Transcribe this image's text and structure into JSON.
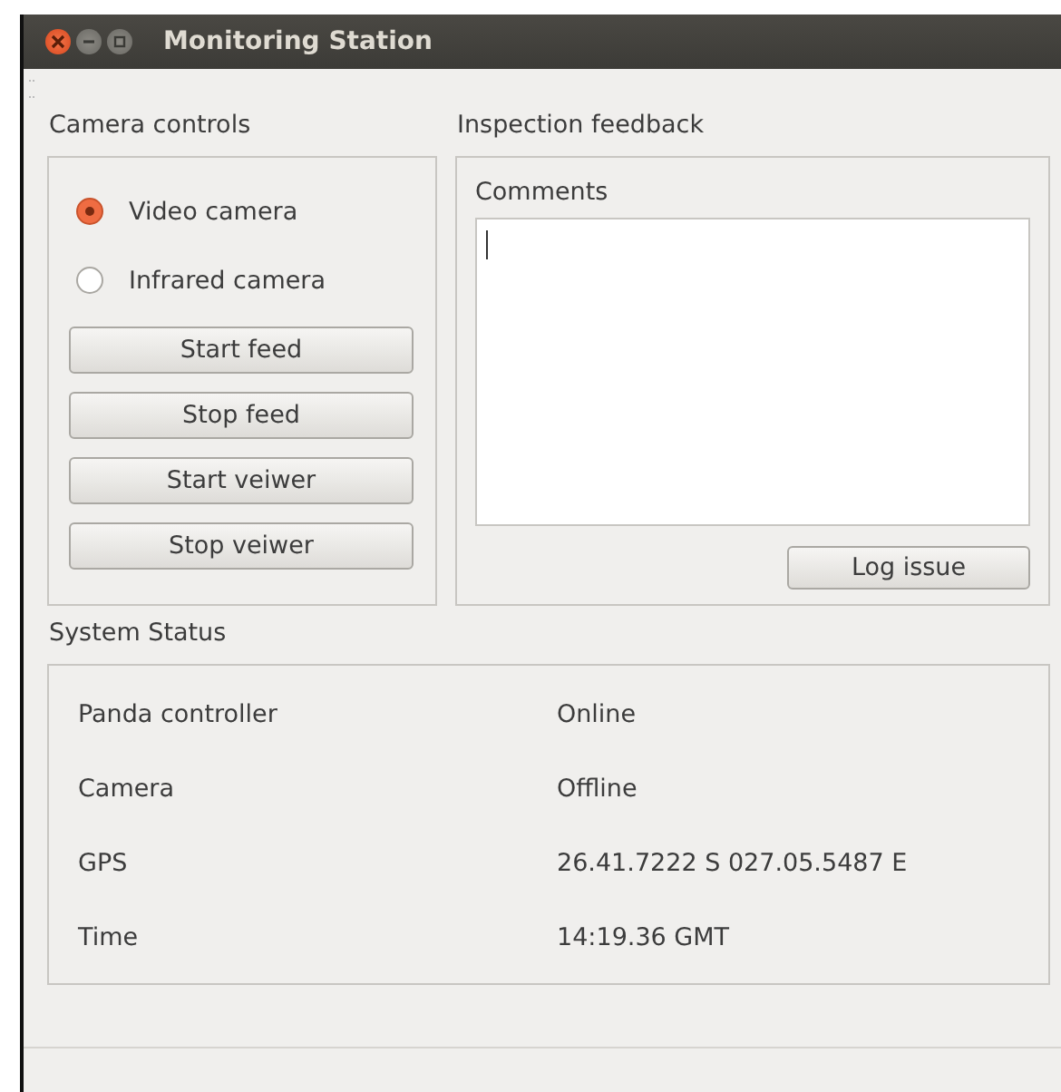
{
  "window": {
    "title": "Monitoring Station"
  },
  "camera_controls": {
    "title": "Camera controls",
    "radios": [
      {
        "label": "Video camera",
        "selected": true
      },
      {
        "label": "Infrared camera",
        "selected": false
      }
    ],
    "buttons": [
      "Start feed",
      "Stop feed",
      "Start veiwer",
      "Stop veiwer"
    ]
  },
  "inspection_feedback": {
    "title": "Inspection feedback",
    "comments_label": "Comments",
    "button": "Log issue"
  },
  "system_status": {
    "title": "System Status",
    "rows": [
      {
        "label": "Panda controller",
        "value": "Online"
      },
      {
        "label": "Camera",
        "value": "Offline"
      },
      {
        "label": "GPS",
        "value": "26.41.7222 S 027.05.5487 E"
      },
      {
        "label": "Time",
        "value": "14:19.36 GMT"
      }
    ]
  }
}
